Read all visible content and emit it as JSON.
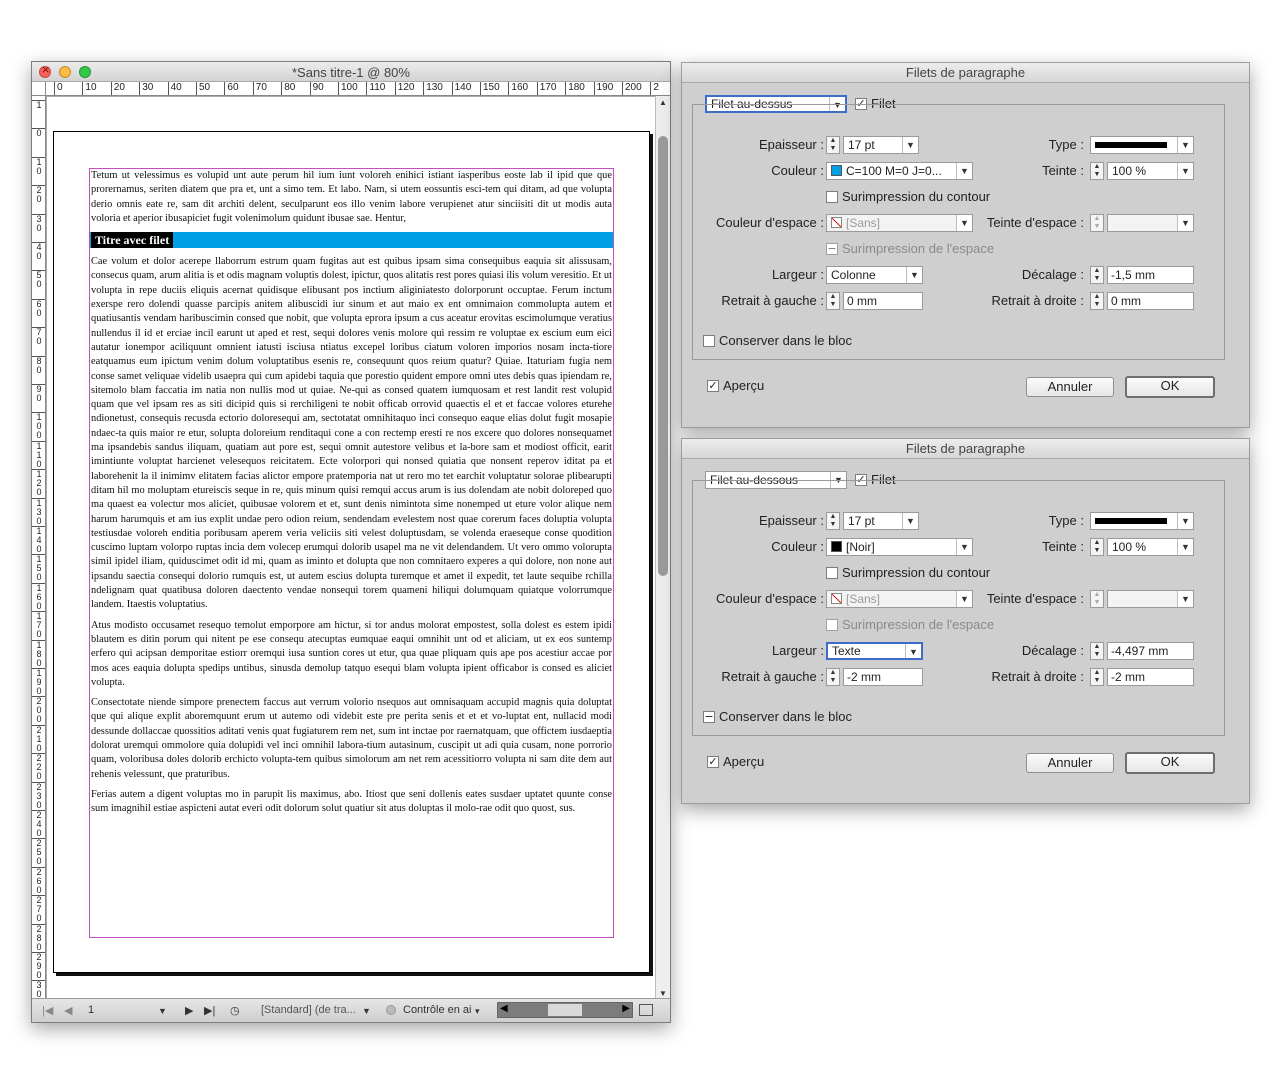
{
  "document": {
    "title": "*Sans titre-1 @ 80%",
    "hruler": [
      "0",
      "10",
      "20",
      "30",
      "40",
      "50",
      "60",
      "70",
      "80",
      "90",
      "100",
      "110",
      "120",
      "130",
      "140",
      "150",
      "160",
      "170",
      "180",
      "190",
      "200",
      "2"
    ],
    "vruler": [
      "1",
      "0",
      "10",
      "20",
      "30",
      "40",
      "50",
      "60",
      "70",
      "80",
      "90",
      "100",
      "110",
      "120",
      "130",
      "140",
      "150",
      "160",
      "170",
      "180",
      "190",
      "200",
      "210",
      "220",
      "230",
      "240",
      "250",
      "260",
      "270",
      "280",
      "290",
      "30"
    ],
    "paragraphs": {
      "p1": "Tetum ut velessimus es volupid unt aute perum hil ium iunt voloreh enihici istiant iasperibus eoste lab il ipid que que prorernamus, seriten diatem que pra et, unt a simo tem. Et labo. Nam, si utem eossuntis esci-tem qui ditam, ad que volupta derio omnis eate re, sam dit architi delent, seculparunt eos illo venim labore verupienet atur sinciisiti dit ut modis auta voloria et aperior ibusapiciet fugit volenimolum quidunt ibusae sae. Hentur,",
      "heading": "Titre avec filet",
      "p2": "Cae volum et dolor acerepe llaborrum estrum quam fugitas aut est quibus ipsam sima consequibus eaquia sit alissusam, consecus quam, arum alitia is et odis magnam voluptis dolest, ipictur, quos alitatis rest pores quiasi ilis volum veresitio. Et ut volupta in repe duciis eliquis acernat quidisque elibusant pos inctium aliginiatesto dolorporunt occuptae. Ferum inctum exerspe rero dolendi quasse parcipis anitem alibuscidi iur sinum et aut maio ex ent omnimaion commolupta autem et quatiusantis vendam haribuscimin consed que nobit, que volupta eprora ipsum a cus aceatur erovitas escimolumque veratius nullendus il id et erciae incil earunt ut aped et rest, sequi dolores venis molore qui ressim re voluptae ex escium eum eici autatur ionempor aciliquunt omnient iatusti isciusa ntiatus excepel loribus ciatum voloren imporios nosam incta-tiore eatquamus eum ipictum venim dolum voluptatibus esenis re, consequunt quos reium quatur? Quiae. Itaturiam fugia nem conse samet veliquae videlib usaepra qui cum apidebi taquia que porestio quident empore omni utes debis quas ipiendam re, sitemolo blam faccatia im natia non nullis mod ut quiae. Ne-qui as consed quatem iumquosam et rest landit rest volupid quam que vel ipsam res as siti dicipid quis si rerchiligeni te nobit officab orrovid quaectis el et et faccae volores eturehe ndionetust, consequis recusda ectorio doloresequi am, sectotatat omnihitaquo inci consequo eaque elias dolut fugit mosapie ndaec-ta quis maior re etur, solupta doloreium renditaqui cone a con rectemp eresti re nos excere quo dolores nonsequamet ma ipsandebis sandus iliquam, quatiam aut pore est, sequi omnit autestore velibus et la-bore sam et modiost officit, earit imintiunte voluptat harcienet velesequos reicitatem. Ecte volorpori qui nonsed quiatia que nonsent reperov iditat pa et laborehenit la il inimimv elitatem facias alictor empore pratemporia nat ut rero mo tet earchit voluptatur solorae plibearupti ditam hil mo moluptam etureiscis seque in re, quis minum quisi remqui accus arum is ius dolendam ate nobit doloreped quo ma quaest ea volectur mos aliciet, quibusae volorem et et, sunt denis nimintota sime nonemped ut eture volor alique nem harum harumquis et am ius explit undae pero odion reium, sendendam evelestem nost quae corerum faces doluptia volupta testiusdae voloreh enditia poribusam aperem veria veliciis siti velest doluptusdam, se volenda eraeseque conse quodition cuscimo luptam volorpo ruptas incia dem volecep erumqui dolorib usapel ma ne vit delendandem. Ut vero ommo volorupta simil ipidel iliam, quiduscimet odit id mi, quam as iminto et dolupta que non comnitaero experes a qui dolore, non none aut ipsandu saectia consequi dolorio rumquis est, ut autem escius dolupta turemque et amet il expedit, tet laute sequibe rchilla ndelignam quat quatibusa doloren daectento vendae nonsequi torem quameni hiliqui dolumquam quiatque volorrumque landem. Itaestis voluptatius.",
      "p3": "Atus modisto occusamet resequo temolut emporpore am hictur, si tor andus molorat empostest, solla dolest es estem ipidi blautem es ditin porum qui nitent pe ese consequ atecuptas eumquae eaqui omnihit unt od et aliciam, ut ex eos suntemp erfero qui acipsan demporitae estiorr oremqui iusa suntion cores ut etur, qua quae pliquam quis ape pos acestiur accae por mos aces eaquia dolupta spedips untibus, sinusda demolup tatquo esequi blam volupta ipient officabor is consed es aliciet volupta.",
      "p4": "Consectotate niende simpore prenectem faccus aut verrum volorio nsequos aut omnisaquam accupid magnis quia doluptat que qui alique explit aboremquunt erum ut autemo odi videbit este pre perita senis et et et vo-luptat ent, nullacid modi dessunde dollaccae quossitios aditati venis quat fugiaturem rem net, sum int inctae por raernatquam, que offictem iusdaeptia dolorat uremqui ommolore quia dolupidi vel inci omnihil labora-tium autasinum, cuscipit ut adi quia cusam, none porrorio quam, voloribusa doles dolorib erchicto volupta-tem quibus simolorum am net rem acessitiorro volupta ni sam dite dem aut rehenis velessunt, que praturibus.",
      "p5": "Ferias autem a digent voluptas mo in parupit lis maximus, abo. Itiost que seni dollenis eates susdaer uptatet quunte conse sum imagnihil estiae aspicteni autat everi odit dolorum solut quatiur sit atus doluptas il molo-rae odit quo quost, sus."
    },
    "status": {
      "page": "1",
      "style": "[Standard] (de tra...",
      "preflight": "Contrôle en ai"
    },
    "accent_rule_color": "#00a0e4"
  },
  "dialog1": {
    "title": "Filets de paragraphe",
    "rule_select": "Filet au-dessus",
    "filet_label": "Filet",
    "filet_checked": "✓",
    "epaisseur_label": "Epaisseur :",
    "epaisseur": "17 pt",
    "type_label": "Type :",
    "couleur_label": "Couleur :",
    "couleur": "C=100 M=0 J=0...",
    "couleur_swatch": "#00a0e4",
    "teinte_label": "Teinte :",
    "teinte": "100 %",
    "surimpression_contour": "Surimpression du contour",
    "couleur_espace_label": "Couleur d'espace :",
    "couleur_espace": "[Sans]",
    "teinte_espace_label": "Teinte d'espace :",
    "surimpression_espace": "Surimpression de l'espace",
    "largeur_label": "Largeur :",
    "largeur": "Colonne",
    "decalage_label": "Décalage :",
    "decalage": "-1,5 mm",
    "retrait_gauche_label": "Retrait à gauche :",
    "retrait_gauche": "0 mm",
    "retrait_droite_label": "Retrait à droite :",
    "retrait_droite": "0 mm",
    "conserver": "Conserver dans le bloc",
    "apercu": "Aperçu",
    "apercu_checked": "✓",
    "annuler": "Annuler",
    "ok": "OK"
  },
  "dialog2": {
    "title": "Filets de paragraphe",
    "rule_select": "Filet au-dessous",
    "filet_label": "Filet",
    "filet_checked": "✓",
    "epaisseur_label": "Epaisseur :",
    "epaisseur": "17 pt",
    "type_label": "Type :",
    "couleur_label": "Couleur :",
    "couleur": "[Noir]",
    "couleur_swatch": "#000000",
    "teinte_label": "Teinte :",
    "teinte": "100 %",
    "surimpression_contour": "Surimpression du contour",
    "couleur_espace_label": "Couleur d'espace :",
    "couleur_espace": "[Sans]",
    "teinte_espace_label": "Teinte d'espace :",
    "surimpression_espace": "Surimpression de l'espace",
    "largeur_label": "Largeur :",
    "largeur": "Texte",
    "decalage_label": "Décalage :",
    "decalage": "-4,497 mm",
    "retrait_gauche_label": "Retrait à gauche :",
    "retrait_gauche": "-2 mm",
    "retrait_droite_label": "Retrait à droite :",
    "retrait_droite": "-2 mm",
    "conserver": "Conserver dans le bloc",
    "conserver_mark": "−",
    "apercu": "Aperçu",
    "apercu_checked": "✓",
    "annuler": "Annuler",
    "ok": "OK"
  }
}
